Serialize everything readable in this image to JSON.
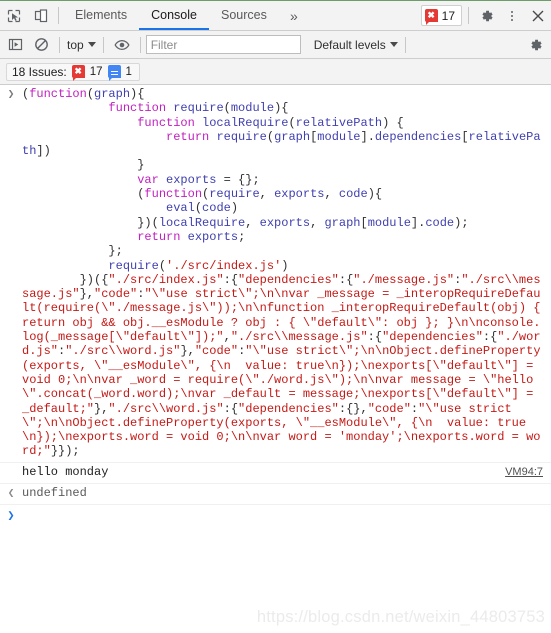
{
  "colors": {
    "accent": "#1a73e8",
    "error": "#e53935",
    "info": "#4285f4",
    "toolbar_bg": "#f3f3f3",
    "keyword": "#c020c0",
    "identifier": "#4040b0",
    "string": "#c41a16"
  },
  "tabbar": {
    "inspect_icon": "inspect-element-icon",
    "device_icon": "device-toolbar-icon",
    "tabs": [
      {
        "label": "Elements",
        "active": false
      },
      {
        "label": "Console",
        "active": true
      },
      {
        "label": "Sources",
        "active": false
      }
    ],
    "more_tabs_label": "»",
    "error_chip": {
      "icon": "error-badge-icon",
      "count": "17"
    },
    "settings_icon": "gear-icon",
    "kebab_icon": "more-options-icon",
    "close_icon": "close-icon"
  },
  "console_toolbar": {
    "execute_icon": "execute-snippet-icon",
    "clear_icon": "clear-console-icon",
    "context_selector": {
      "value": "top",
      "caret": "▼"
    },
    "eye_icon": "live-expression-icon",
    "filter": {
      "value": "",
      "placeholder": "Filter"
    },
    "levels_selector": {
      "value": "Default levels",
      "caret": "▼"
    },
    "settings_icon": "console-settings-icon"
  },
  "issues_bar": {
    "label": "18 Issues:",
    "error_icon": "error-badge-icon",
    "error_count": "17",
    "info_icon": "info-badge-icon",
    "info_count": "1"
  },
  "console_messages": [
    {
      "type": "input",
      "gutter": "❯",
      "tokens": [
        {
          "t": "(",
          "c": "p"
        },
        {
          "t": "function",
          "c": "k"
        },
        {
          "t": "(",
          "c": "p"
        },
        {
          "t": "graph",
          "c": "id"
        },
        {
          "t": "){\n            ",
          "c": "p"
        },
        {
          "t": "function",
          "c": "k"
        },
        {
          "t": " ",
          "c": "p"
        },
        {
          "t": "require",
          "c": "id"
        },
        {
          "t": "(",
          "c": "p"
        },
        {
          "t": "module",
          "c": "id"
        },
        {
          "t": "){\n                ",
          "c": "p"
        },
        {
          "t": "function",
          "c": "k"
        },
        {
          "t": " ",
          "c": "p"
        },
        {
          "t": "localRequire",
          "c": "id"
        },
        {
          "t": "(",
          "c": "p"
        },
        {
          "t": "relativePath",
          "c": "id"
        },
        {
          "t": ") {\n                    ",
          "c": "p"
        },
        {
          "t": "return",
          "c": "k"
        },
        {
          "t": " ",
          "c": "p"
        },
        {
          "t": "require",
          "c": "id"
        },
        {
          "t": "(",
          "c": "p"
        },
        {
          "t": "graph",
          "c": "id"
        },
        {
          "t": "[",
          "c": "p"
        },
        {
          "t": "module",
          "c": "id"
        },
        {
          "t": "].",
          "c": "p"
        },
        {
          "t": "dependencies",
          "c": "id"
        },
        {
          "t": "[",
          "c": "p"
        },
        {
          "t": "relativePath",
          "c": "id"
        },
        {
          "t": "])\n                ",
          "c": "p"
        },
        {
          "t": "}\n                ",
          "c": "p"
        },
        {
          "t": "var",
          "c": "k"
        },
        {
          "t": " ",
          "c": "p"
        },
        {
          "t": "exports",
          "c": "id"
        },
        {
          "t": " = {};\n                (",
          "c": "p"
        },
        {
          "t": "function",
          "c": "k"
        },
        {
          "t": "(",
          "c": "p"
        },
        {
          "t": "require",
          "c": "id"
        },
        {
          "t": ", ",
          "c": "p"
        },
        {
          "t": "exports",
          "c": "id"
        },
        {
          "t": ", ",
          "c": "p"
        },
        {
          "t": "code",
          "c": "id"
        },
        {
          "t": "){\n                    ",
          "c": "p"
        },
        {
          "t": "eval",
          "c": "id"
        },
        {
          "t": "(",
          "c": "p"
        },
        {
          "t": "code",
          "c": "id"
        },
        {
          "t": ")\n                })(",
          "c": "p"
        },
        {
          "t": "localRequire",
          "c": "id"
        },
        {
          "t": ", ",
          "c": "p"
        },
        {
          "t": "exports",
          "c": "id"
        },
        {
          "t": ", ",
          "c": "p"
        },
        {
          "t": "graph",
          "c": "id"
        },
        {
          "t": "[",
          "c": "p"
        },
        {
          "t": "module",
          "c": "id"
        },
        {
          "t": "].",
          "c": "p"
        },
        {
          "t": "code",
          "c": "id"
        },
        {
          "t": ");\n                ",
          "c": "p"
        },
        {
          "t": "return",
          "c": "k"
        },
        {
          "t": " ",
          "c": "p"
        },
        {
          "t": "exports",
          "c": "id"
        },
        {
          "t": ";\n            };\n            ",
          "c": "p"
        },
        {
          "t": "require",
          "c": "id"
        },
        {
          "t": "(",
          "c": "p"
        },
        {
          "t": "'./src/index.js'",
          "c": "s"
        },
        {
          "t": ")\n        })({",
          "c": "p"
        },
        {
          "t": "\"./src/index.js\"",
          "c": "s"
        },
        {
          "t": ":{",
          "c": "p"
        },
        {
          "t": "\"dependencies\"",
          "c": "s"
        },
        {
          "t": ":",
          "c": "p"
        },
        {
          "t": "{",
          "c": "p"
        },
        {
          "t": "\"./message.js\"",
          "c": "s"
        },
        {
          "t": ":",
          "c": "p"
        },
        {
          "t": "\"./src\\\\message.js\"",
          "c": "s"
        },
        {
          "t": "},",
          "c": "p"
        },
        {
          "t": "\"code\"",
          "c": "s"
        },
        {
          "t": ":",
          "c": "p"
        },
        {
          "t": "\"\\\"use strict\\\";\\n\\nvar _message = _interopRequireDefault(require(\\\"./message.js\\\"));\\n\\nfunction _interopRequireDefault(obj) { return obj && obj.__esModule ? obj : { \\\"default\\\": obj }; }\\n\\nconsole.log(_message[\\\"default\\\"]);\"",
          "c": "s"
        },
        {
          "t": ",",
          "c": "p"
        },
        {
          "t": "\"./src\\\\message.js\"",
          "c": "s"
        },
        {
          "t": ":",
          "c": "p"
        },
        {
          "t": "{",
          "c": "p"
        },
        {
          "t": "\"dependencies\"",
          "c": "s"
        },
        {
          "t": ":{",
          "c": "p"
        },
        {
          "t": "\"./word.js\"",
          "c": "s"
        },
        {
          "t": ":",
          "c": "p"
        },
        {
          "t": "\"./src\\\\word.js\"",
          "c": "s"
        },
        {
          "t": "},",
          "c": "p"
        },
        {
          "t": "\"code\"",
          "c": "s"
        },
        {
          "t": ":",
          "c": "p"
        },
        {
          "t": "\"\\\"use strict\\\";\\n\\nObject.defineProperty(exports, \\\"__esModule\\\", {\\n  value: true\\n});\\nexports[\\\"default\\\"] = void 0;\\n\\nvar _word = require(\\\"./word.js\\\");\\n\\nvar message = \\\"hello \\\".concat(_word.word);\\nvar _default = message;\\nexports[\\\"default\\\"] = _default;\"",
          "c": "s"
        },
        {
          "t": "},",
          "c": "p"
        },
        {
          "t": "\"./src\\\\word.js\"",
          "c": "s"
        },
        {
          "t": ":",
          "c": "p"
        },
        {
          "t": "{",
          "c": "p"
        },
        {
          "t": "\"dependencies\"",
          "c": "s"
        },
        {
          "t": ":{},",
          "c": "p"
        },
        {
          "t": "\"code\"",
          "c": "s"
        },
        {
          "t": ":",
          "c": "p"
        },
        {
          "t": "\"\\\"use strict\\\";\\n\\nObject.defineProperty(exports, \\\"__esModule\\\", {\\n  value: true\\n});\\nexports.word = void 0;\\n\\nvar word = 'monday';\\nexports.word = word;\"",
          "c": "s"
        },
        {
          "t": "}});",
          "c": "p"
        }
      ]
    },
    {
      "type": "log",
      "gutter": "",
      "text": "hello monday",
      "source_link": "VM94:7"
    },
    {
      "type": "output",
      "gutter": "❮",
      "text": "undefined"
    }
  ],
  "prompt": {
    "caret": "❯",
    "value": ""
  },
  "watermark": "https://blog.csdn.net/weixin_44803753"
}
